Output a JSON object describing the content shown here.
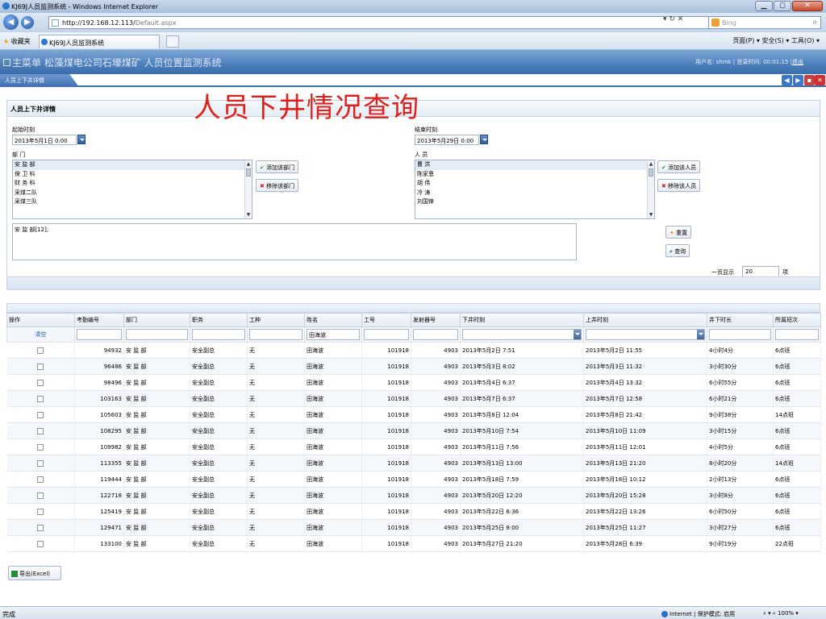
{
  "browser": {
    "window_title": "KJ69J人员监测系统 - Windows Internet Explorer",
    "address_host": "http://192.168.12.113/",
    "address_path": "Default.aspx",
    "search_placeholder": "Bing",
    "favorites_label": "收藏夹",
    "tab_title": "KJ69J人员监测系统",
    "command_bar": "页面(P) ▾  安全(S) ▾  工具(O) ▾",
    "status_left": "完成",
    "status_zone": "Internet | 保护模式: 启用",
    "status_zoom": "100%",
    "win_min": "▁",
    "win_max": "◻",
    "win_close": "✕"
  },
  "app": {
    "header": "主菜单 松藻煤电公司石壕煤矿  人员位置监测系统",
    "user_info": "用户名: shmk | 登录时间: 00:01:15 |",
    "logout": "退出",
    "active_tab": "人员上下井详情"
  },
  "page": {
    "big_title": "人员下井情况查询",
    "panel_title": "人员上下井详情"
  },
  "form": {
    "start_label": "起始时刻",
    "start_value": "2013年5月1日 0:00",
    "end_label": "结束时刻",
    "end_value": "2013年5月29日 0:00",
    "dept_label": "部 门",
    "person_label": "人 员",
    "departments": [
      "安 监 部",
      "保 卫 科",
      "财 务 科",
      "采煤二队",
      "采煤三队"
    ],
    "persons": [
      "曹  洪",
      "陈家恩",
      "胡  伟",
      "冷  涛",
      "刘国锋"
    ],
    "add_dept": "添加该部门",
    "remove_dept": "移除该部门",
    "add_person": "添加该人员",
    "remove_person": "移除该人员",
    "selection_text": "安 监 部[12];",
    "reset": "重置",
    "query": "查询",
    "page_size_label": "一页显示",
    "page_size_value": "20",
    "page_size_unit": "项"
  },
  "grid": {
    "headers": [
      "操作",
      "考勤编号",
      "部门",
      "职务",
      "工种",
      "姓名",
      "工号",
      "发射器号",
      "下井时刻",
      "上井时刻",
      "井下时长",
      "所属班次"
    ],
    "clear_label": "清空",
    "filter_name": "田海波",
    "rows": [
      [
        "94932",
        "安 监 部",
        "安全副总",
        "无",
        "田海波",
        "101918",
        "4903",
        "2013年5月2日 7:51",
        "2013年5月2日 11:55",
        "4小时4分",
        "6点班"
      ],
      [
        "96486",
        "安 监 部",
        "安全副总",
        "无",
        "田海波",
        "101918",
        "4903",
        "2013年5月3日 8:02",
        "2013年5月3日 11:32",
        "3小时30分",
        "6点班"
      ],
      [
        "98496",
        "安 监 部",
        "安全副总",
        "无",
        "田海波",
        "101918",
        "4903",
        "2013年5月4日 6:37",
        "2013年5月4日 13:32",
        "6小时55分",
        "6点班"
      ],
      [
        "103163",
        "安 监 部",
        "安全副总",
        "无",
        "田海波",
        "101918",
        "4903",
        "2013年5月7日 6:37",
        "2013年5月7日 12:58",
        "6小时21分",
        "6点班"
      ],
      [
        "105603",
        "安 监 部",
        "安全副总",
        "无",
        "田海波",
        "101918",
        "4903",
        "2013年5月8日 12:04",
        "2013年5月8日 21:42",
        "9小时38分",
        "14点班"
      ],
      [
        "108295",
        "安 监 部",
        "安全副总",
        "无",
        "田海波",
        "101918",
        "4903",
        "2013年5月10日 7:54",
        "2013年5月10日 11:09",
        "3小时15分",
        "6点班"
      ],
      [
        "109982",
        "安 监 部",
        "安全副总",
        "无",
        "田海波",
        "101918",
        "4903",
        "2013年5月11日 7:56",
        "2013年5月11日 12:01",
        "4小时5分",
        "6点班"
      ],
      [
        "113355",
        "安 监 部",
        "安全副总",
        "无",
        "田海波",
        "101918",
        "4903",
        "2013年5月13日 13:00",
        "2013年5月13日 21:20",
        "8小时20分",
        "14点班"
      ],
      [
        "119444",
        "安 监 部",
        "安全副总",
        "无",
        "田海波",
        "101918",
        "4903",
        "2013年5月18日 7:59",
        "2013年5月18日 10:12",
        "2小时13分",
        "6点班"
      ],
      [
        "122718",
        "安 监 部",
        "安全副总",
        "无",
        "田海波",
        "101918",
        "4903",
        "2013年5月20日 12:20",
        "2013年5月20日 15:28",
        "3小时8分",
        "6点班"
      ],
      [
        "125419",
        "安 监 部",
        "安全副总",
        "无",
        "田海波",
        "101918",
        "4903",
        "2013年5月22日 6:36",
        "2013年5月22日 13:26",
        "6小时50分",
        "6点班"
      ],
      [
        "129471",
        "安 监 部",
        "安全副总",
        "无",
        "田海波",
        "101918",
        "4903",
        "2013年5月25日 8:00",
        "2013年5月25日 11:27",
        "3小时27分",
        "6点班"
      ],
      [
        "133100",
        "安 监 部",
        "安全副总",
        "无",
        "田海波",
        "101918",
        "4903",
        "2013年5月27日 21:20",
        "2013年5月28日 6:39",
        "9小时19分",
        "22点班"
      ]
    ],
    "export_label": "导出(Excel)"
  }
}
